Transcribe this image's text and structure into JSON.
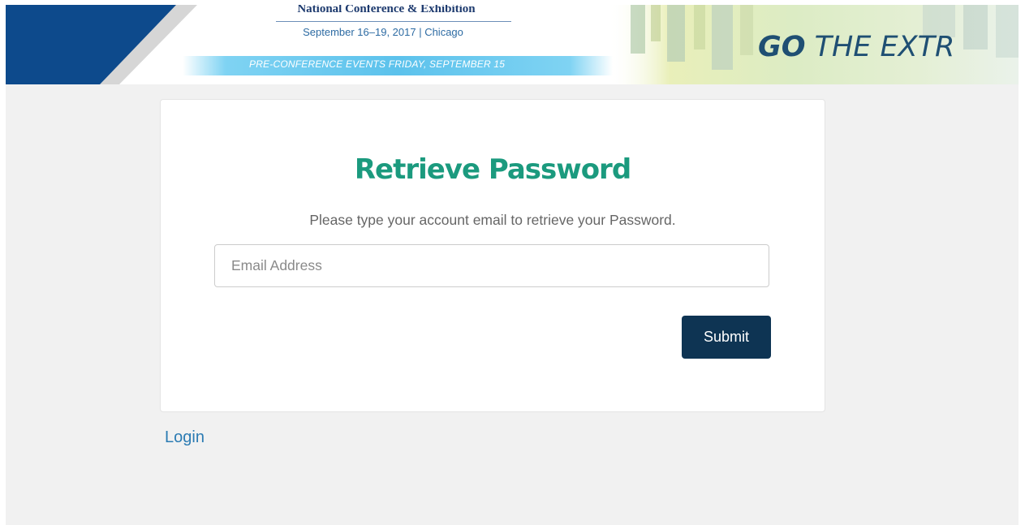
{
  "banner": {
    "conference_name": "National Conference & Exhibition",
    "dates_location": "September 16–19, 2017 | Chicago",
    "pre_conference": "PRE-CONFERENCE EVENTS FRIDAY, SEPTEMBER 15",
    "tagline_bold": "GO",
    "tagline_rest": " THE EXTR",
    "colors": {
      "navy": "#0d4a8c",
      "light_blue": "#5cc2ec",
      "tagline": "#1f4f73"
    }
  },
  "card": {
    "title": "Retrieve Password",
    "instructions": "Please type your account email to retrieve your Password.",
    "email_placeholder": "Email Address",
    "email_value": "",
    "submit_label": "Submit"
  },
  "login_link": "Login",
  "colors": {
    "title_green": "#1b9a7e",
    "button_navy": "#0e3453",
    "link_blue": "#2b7bb3",
    "page_bg": "#f1f1f1"
  }
}
